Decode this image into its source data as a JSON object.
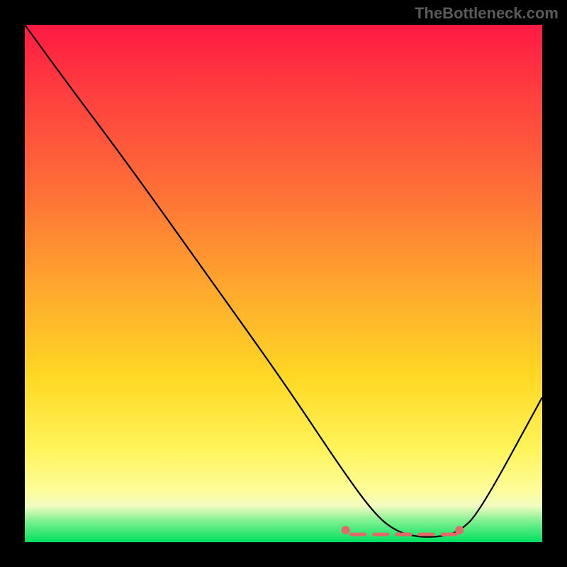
{
  "watermark": "TheBottleneck.com",
  "chart_data": {
    "type": "line",
    "title": "",
    "xlabel": "",
    "ylabel": "",
    "xlim": [
      0,
      100
    ],
    "ylim": [
      0,
      100
    ],
    "grid": false,
    "legend": false,
    "series": [
      {
        "name": "bottleneck-curve",
        "x": [
          0,
          8,
          20,
          35,
          50,
          62,
          68,
          72,
          76,
          80,
          84,
          88,
          100
        ],
        "values": [
          100,
          89,
          73,
          52,
          31,
          13,
          5,
          2,
          1,
          1,
          2,
          6,
          28
        ]
      }
    ],
    "marker_band": {
      "name": "optimal-range",
      "x_start": 62,
      "x_end": 84,
      "y": 1.5
    }
  }
}
